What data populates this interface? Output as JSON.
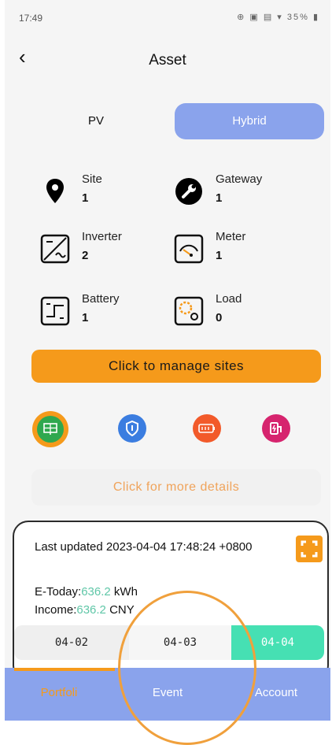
{
  "status_bar": {
    "time": "17:49",
    "icons": "⊕ ▣ ▤ ▾ 35% ▮"
  },
  "header": {
    "title": "Asset"
  },
  "segment": {
    "pv": "PV",
    "hybrid": "Hybrid",
    "active": "Hybrid"
  },
  "assets": {
    "site": {
      "label": "Site",
      "value": "1"
    },
    "gateway": {
      "label": "Gateway",
      "value": "1"
    },
    "inverter": {
      "label": "Inverter",
      "value": "2"
    },
    "meter": {
      "label": "Meter",
      "value": "1"
    },
    "battery": {
      "label": "Battery",
      "value": "1"
    },
    "load": {
      "label": "Load",
      "value": "0"
    }
  },
  "buttons": {
    "manage": "Click to manage sites",
    "more": "Click for more details"
  },
  "summary": {
    "updated": "Last updated 2023-04-04 17:48:24 +0800",
    "etoday_label": "E-Today:",
    "etoday_value": "636.2",
    "etoday_unit": " kWh",
    "income_label": "Income:",
    "income_value": "636.2",
    "income_unit": " CNY"
  },
  "dates": [
    "04-02",
    "04-03",
    "04-04"
  ],
  "tabs": {
    "portfolio": "Portfoli",
    "event": "Event",
    "account": "Account"
  },
  "colors": {
    "accent": "#f59a1b",
    "primary": "#8aa3ec",
    "success": "#46e0b3"
  }
}
